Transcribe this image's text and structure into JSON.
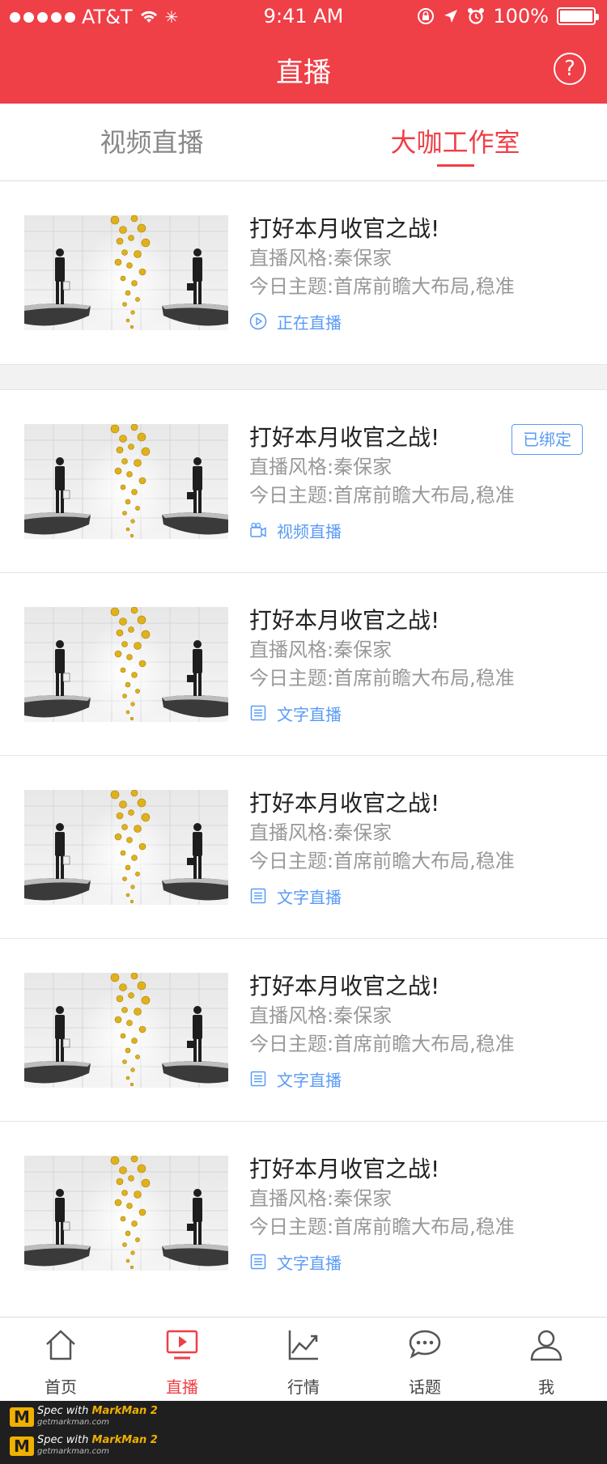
{
  "status_bar": {
    "carrier": "AT&T",
    "time": "9:41 AM",
    "battery": "100%"
  },
  "nav": {
    "title": "直播",
    "help": "?"
  },
  "tabs": [
    {
      "label": "视频直播"
    },
    {
      "label": "大咖工作室"
    }
  ],
  "items": [
    {
      "title": "打好本月收官之战!",
      "style": "直播风格:秦保家",
      "topic": "今日主题:首席前瞻大布局,稳准",
      "status": "正在直播",
      "icon": "play-circle-icon",
      "bound": ""
    },
    {
      "title": "打好本月收官之战!",
      "style": "直播风格:秦保家",
      "topic": "今日主题:首席前瞻大布局,稳准",
      "status": "视频直播",
      "icon": "video-camera-icon",
      "bound": "已绑定"
    },
    {
      "title": "打好本月收官之战!",
      "style": "直播风格:秦保家",
      "topic": "今日主题:首席前瞻大布局,稳准",
      "status": "文字直播",
      "icon": "document-icon",
      "bound": ""
    },
    {
      "title": "打好本月收官之战!",
      "style": "直播风格:秦保家",
      "topic": "今日主题:首席前瞻大布局,稳准",
      "status": "文字直播",
      "icon": "document-icon",
      "bound": ""
    },
    {
      "title": "打好本月收官之战!",
      "style": "直播风格:秦保家",
      "topic": "今日主题:首席前瞻大布局,稳准",
      "status": "文字直播",
      "icon": "document-icon",
      "bound": ""
    },
    {
      "title": "打好本月收官之战!",
      "style": "直播风格:秦保家",
      "topic": "今日主题:首席前瞻大布局,稳准",
      "status": "文字直播",
      "icon": "document-icon",
      "bound": ""
    }
  ],
  "tabbar": [
    {
      "label": "首页",
      "icon": "home-icon"
    },
    {
      "label": "直播",
      "icon": "live-icon"
    },
    {
      "label": "行情",
      "icon": "chart-icon"
    },
    {
      "label": "话题",
      "icon": "chat-icon"
    },
    {
      "label": "我",
      "icon": "user-icon"
    }
  ],
  "footer": {
    "brand": "Spec with",
    "product": "MarkMan 2",
    "site": "getmarkman.com"
  },
  "colors": {
    "primary": "#ef3f47",
    "link": "#599bf6",
    "title": "#222222",
    "secondary": "#999999"
  }
}
